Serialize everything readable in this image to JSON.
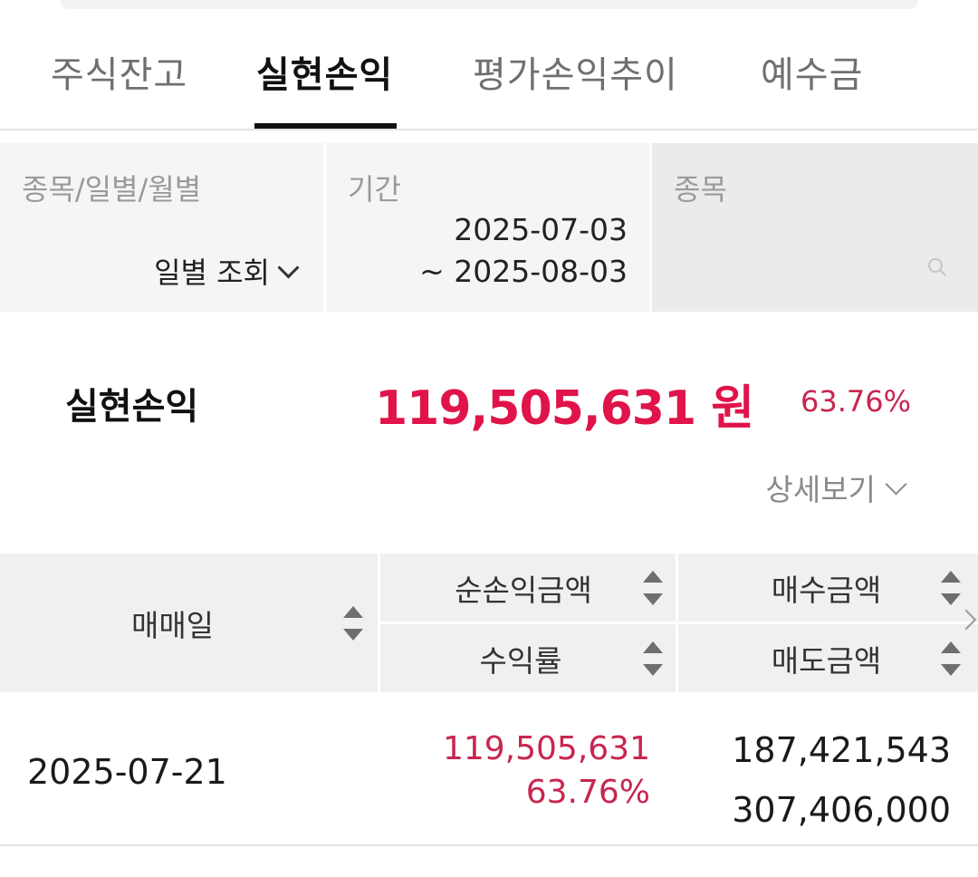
{
  "tabs": [
    {
      "label": "주식잔고",
      "active": false
    },
    {
      "label": "실현손익",
      "active": true
    },
    {
      "label": "평가손익추이",
      "active": false
    },
    {
      "label": "예수금",
      "active": false
    }
  ],
  "filter": {
    "mode_label": "종목/일별/월별",
    "mode_value": "일별 조회",
    "period_label": "기간",
    "period_start": "2025-07-03",
    "period_end": "~ 2025-08-03",
    "stock_label": "종목"
  },
  "summary": {
    "label": "실현손익",
    "amount": "119,505,631 원",
    "rate": "63.76%",
    "detail_label": "상세보기"
  },
  "table": {
    "headers": {
      "date": "매매일",
      "net_profit": "순손익금액",
      "buy_amount": "매수금액",
      "return_rate": "수익률",
      "sell_amount": "매도금액"
    },
    "rows": [
      {
        "date": "2025-07-21",
        "net_profit": "119,505,631",
        "return_rate": "63.76%",
        "buy_amount": "187,421,543",
        "sell_amount": "307,406,000"
      }
    ]
  },
  "colors": {
    "accent": "#e0144a",
    "profit_text": "#c8264f",
    "tab_active": "#111111"
  }
}
